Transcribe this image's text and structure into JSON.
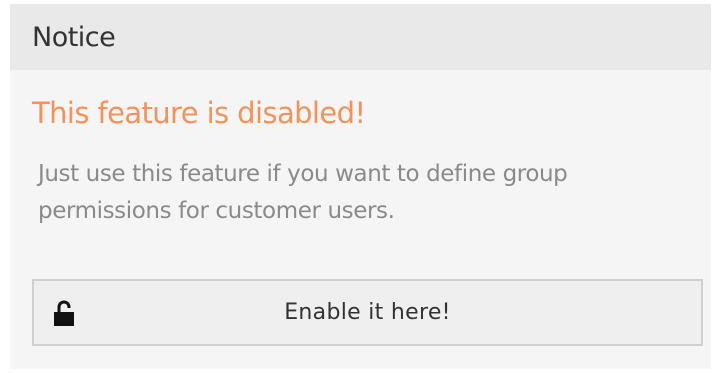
{
  "notice": {
    "title": "Notice",
    "warning": "This feature is disabled!",
    "description": "Just use this feature if you want to define group permissions for customer users.",
    "button": {
      "label": "Enable it here!",
      "icon": "unlock-icon"
    }
  },
  "colors": {
    "warning": "#f4925a",
    "header_background": "#e9e9e9",
    "panel_background": "#f5f5f5",
    "description_text": "#8a8a8a"
  }
}
